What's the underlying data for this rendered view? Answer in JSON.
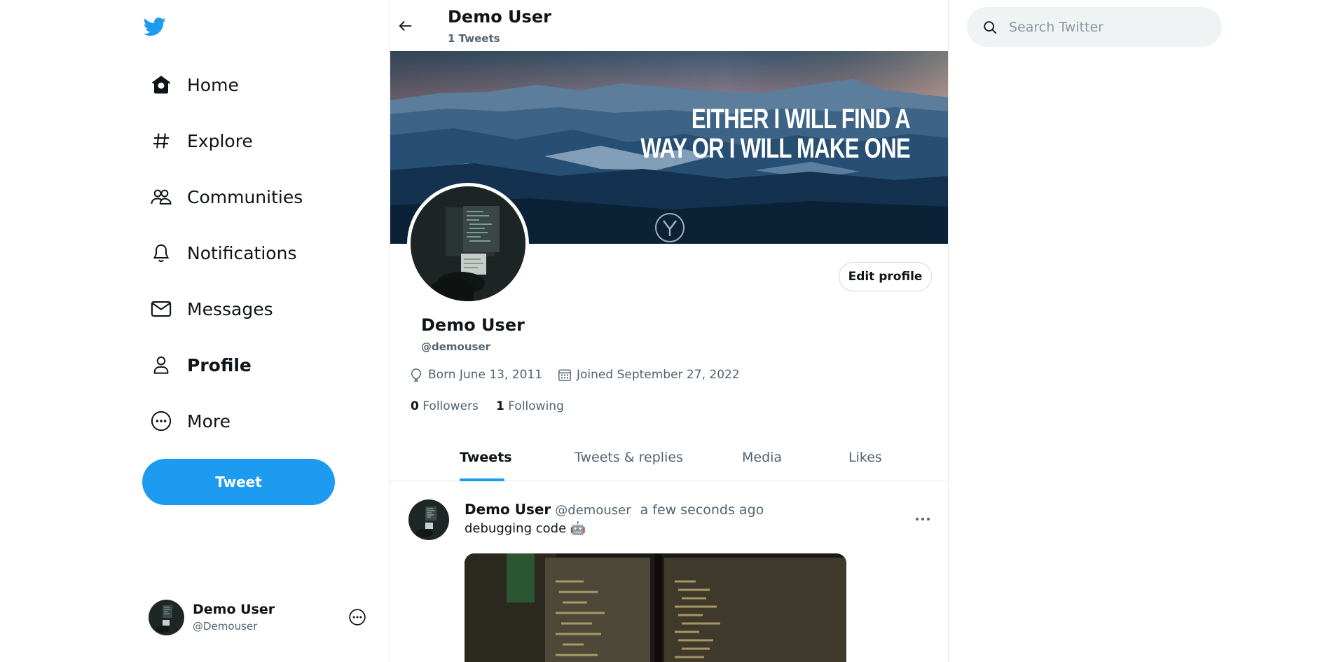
{
  "sidebar": {
    "logo_icon": "twitter-bird-icon",
    "brand_color": "#1d9bf0",
    "nav": [
      {
        "label": "Home",
        "icon": "home-icon"
      },
      {
        "label": "Explore",
        "icon": "hashtag-icon"
      },
      {
        "label": "Communities",
        "icon": "communities-icon"
      },
      {
        "label": "Notifications",
        "icon": "bell-icon"
      },
      {
        "label": "Messages",
        "icon": "envelope-icon"
      },
      {
        "label": "Profile",
        "icon": "person-icon"
      },
      {
        "label": "More",
        "icon": "more-circle-icon"
      }
    ],
    "active_item": "Profile",
    "tweet_button": "Tweet",
    "account": {
      "name": "Demo User",
      "handle": "@Demouser"
    }
  },
  "header": {
    "title": "Demo User",
    "subtitle": "1 Tweets"
  },
  "banner": {
    "quote_line1": "EITHER I WILL FIND A",
    "quote_line2": "WAY OR I WILL MAKE ONE"
  },
  "profile": {
    "edit_button": "Edit profile",
    "name": "Demo User",
    "handle": "@demouser",
    "born": "Born June 13, 2011",
    "joined": "Joined September 27, 2022",
    "followers_count": "0",
    "followers_label": "Followers",
    "following_count": "1",
    "following_label": "Following"
  },
  "tabs": [
    {
      "label": "Tweets",
      "active": true
    },
    {
      "label": "Tweets & replies",
      "active": false
    },
    {
      "label": "Media",
      "active": false
    },
    {
      "label": "Likes",
      "active": false
    }
  ],
  "tweet": {
    "name": "Demo User",
    "handle": "@demouser",
    "time": "a few seconds ago",
    "text": "debugging code 🤖"
  },
  "search": {
    "placeholder": "Search Twitter"
  }
}
